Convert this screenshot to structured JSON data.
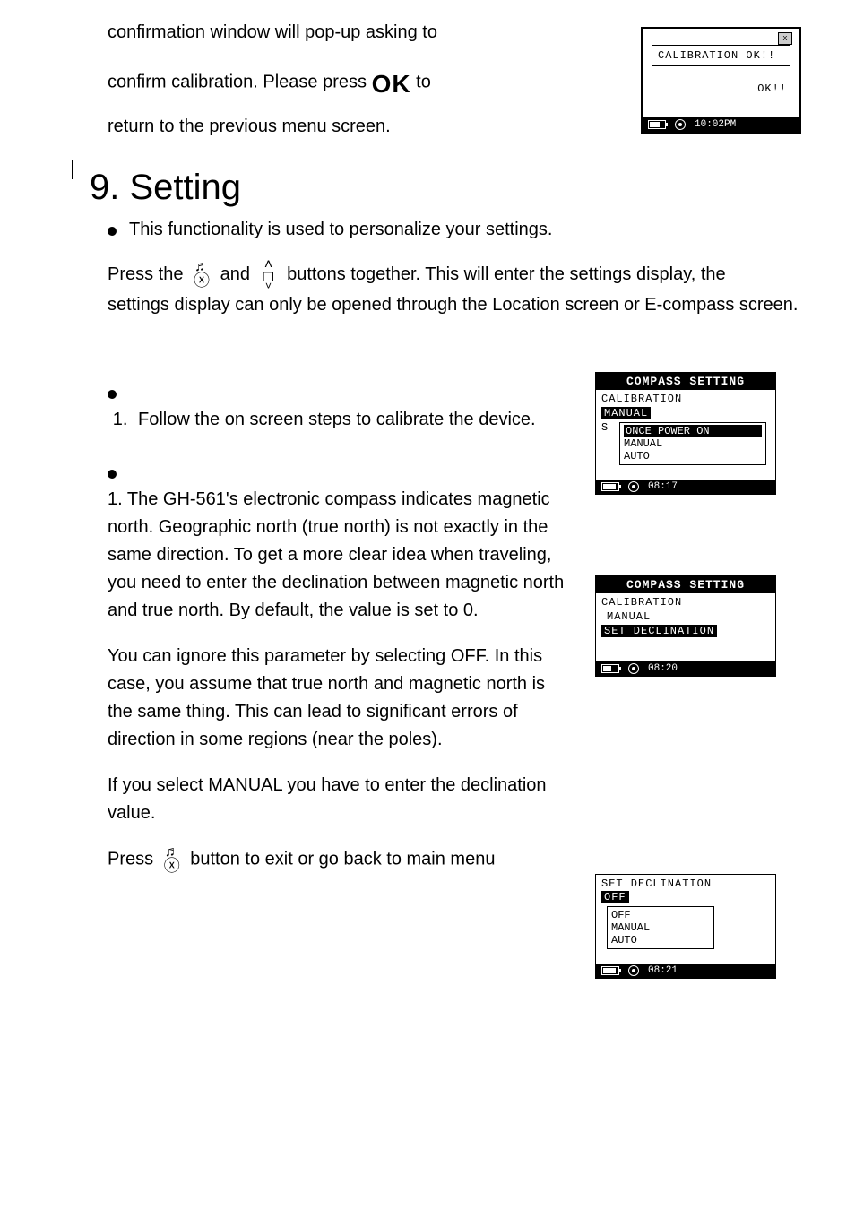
{
  "top": {
    "line1": "confirmation window will pop-up asking to",
    "line2a": "confirm calibration. Please press ",
    "ok_label": "OK",
    "line2b": " to",
    "line3": "return to the previous menu screen."
  },
  "lcd_cal_ok": {
    "box_text": "CALIBRATION OK!!",
    "ok_text": "OK!!",
    "time": "10:02PM"
  },
  "heading": "9. Setting",
  "intro_bullet": "This functionality is used to personalize your settings.",
  "press": {
    "prefix": "Press the ",
    "mid": " and ",
    "suffix": " buttons together. This will enter the settings display, the",
    "line2": "settings display can only be opened through the Location screen or E-compass screen."
  },
  "calibrate": {
    "item1_text": "Follow the on screen steps to calibrate the device."
  },
  "declination": {
    "para1": "1. The GH-561's electronic compass indicates magnetic north. Geographic north (true north) is not exactly in the same direction. To get a more clear idea when traveling, you need to enter the declination between magnetic north and true north. By default, the value is set to 0.",
    "para2": "You can ignore this parameter by selecting OFF. In this case, you assume that true north and magnetic north is the same thing. This can lead to significant errors of direction in some regions (near the poles).",
    "para3": "If you select MANUAL you have to enter the declination value.",
    "press_prefix": "Press ",
    "press_suffix": " button to exit or go back to main menu"
  },
  "lcd_compass1": {
    "title": "COMPASS SETTING",
    "l1": "CALIBRATION",
    "l2_hl": "MANUAL",
    "s_label": "S",
    "menu_sel": "ONCE POWER ON",
    "menu_2": "MANUAL",
    "menu_3": "AUTO",
    "time": "08:17"
  },
  "lcd_compass2": {
    "title": "COMPASS SETTING",
    "l1": "CALIBRATION",
    "l2": "MANUAL",
    "l3_hl": "SET DECLINATION",
    "time": "08:20"
  },
  "lcd_setdecl": {
    "title": "SET DECLINATION",
    "current_hl": "OFF",
    "menu_1": "OFF",
    "menu_2": "MANUAL",
    "menu_3": "AUTO",
    "time": "08:21"
  }
}
